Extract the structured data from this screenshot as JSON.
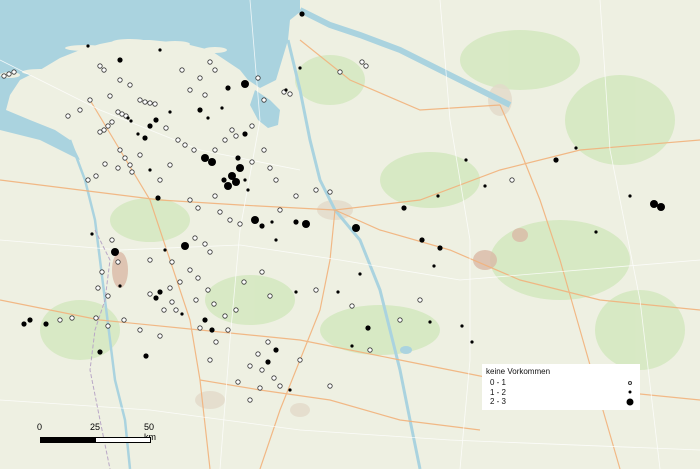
{
  "legend": {
    "title": "keine Vorkommen",
    "items": [
      {
        "label": "0 - 1",
        "kind": "zero"
      },
      {
        "label": "1 - 2",
        "kind": "one"
      },
      {
        "label": "2 - 3",
        "kind": "two"
      }
    ]
  },
  "scale_bar": {
    "labels": [
      "0",
      "25",
      "50 km"
    ]
  },
  "colors": {
    "land": "#eef0e2",
    "water": "#aad3df",
    "forest": "#cfe6b9",
    "road": "#f6c99d",
    "symbol": "#000000"
  },
  "occurrence_marks": "scattered points over northwestern Germany: open circles = keine Vorkommen, small dots = 0 - 1 / 1 - 2, large dots = 2 - 3"
}
